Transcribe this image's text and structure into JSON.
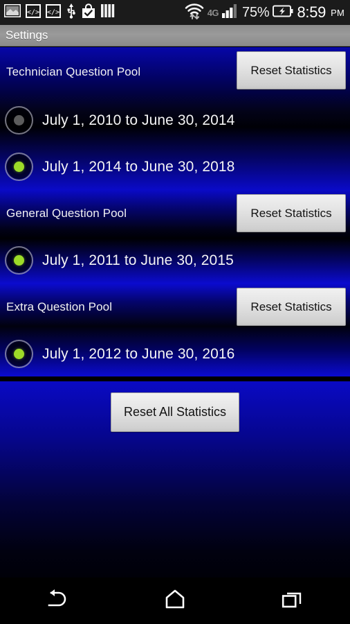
{
  "status_bar": {
    "icons_left": [
      "screenshot-icon",
      "code-brackets-icon-1",
      "code-brackets-icon-2",
      "usb-icon",
      "shopping-bag-check-icon",
      "vpn-bars-icon"
    ],
    "wifi_icon": "wifi-with-data-arrows-icon",
    "network_type": "4G",
    "signal_icon": "cellular-signal-icon",
    "battery_percent": "75%",
    "battery_icon": "battery-charging-icon",
    "time": "8:59",
    "ampm": "PM"
  },
  "action_bar": {
    "title": "Settings"
  },
  "pools": [
    {
      "title": "Technician Question Pool",
      "reset_label": "Reset Statistics",
      "options": [
        {
          "label": "July 1, 2010 to June 30, 2014",
          "checked": false
        },
        {
          "label": "July 1, 2014 to June 30, 2018",
          "checked": true
        }
      ]
    },
    {
      "title": "General Question Pool",
      "reset_label": "Reset Statistics",
      "options": [
        {
          "label": "July 1, 2011 to June 30, 2015",
          "checked": true
        }
      ]
    },
    {
      "title": "Extra Question Pool",
      "reset_label": "Reset Statistics",
      "options": [
        {
          "label": "July 1, 2012 to June 30, 2016",
          "checked": true
        }
      ]
    }
  ],
  "footer": {
    "reset_all_label": "Reset All Statistics"
  },
  "nav_bar": {
    "back_icon": "back-arrow-icon",
    "home_icon": "home-icon",
    "recents_icon": "recent-apps-icon"
  },
  "colors": {
    "accent_blue": "#0b0bd0",
    "panel_black": "#000006",
    "radio_checked": "#9ddb28",
    "radio_unchecked": "#5c5c5c",
    "button_face": "#e4e4e4",
    "action_bar": "#9a9a9a",
    "status_bar": "#1b1b1b"
  }
}
